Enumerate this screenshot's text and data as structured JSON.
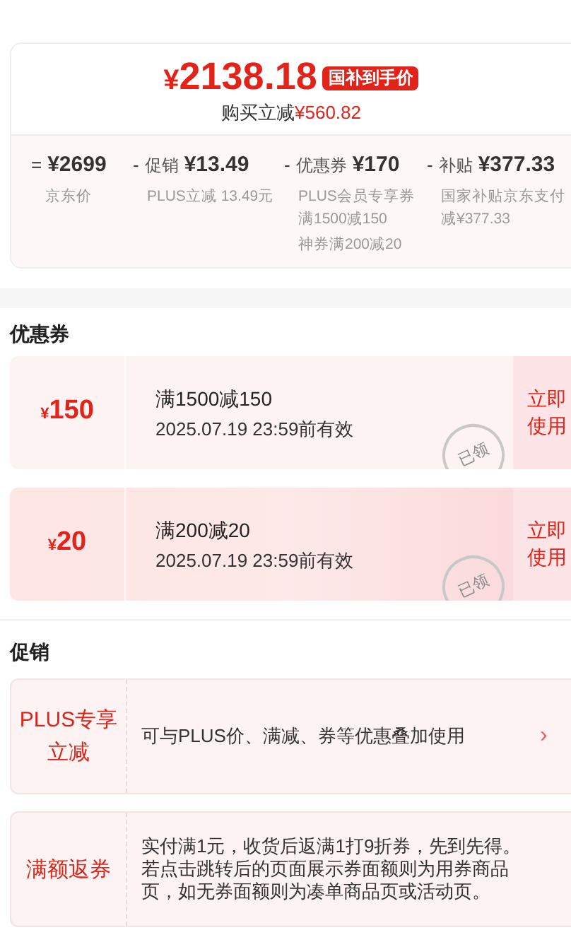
{
  "price": {
    "currency": "¥",
    "amount": "2138.18",
    "badge": "国补到手价",
    "saving_label": "购买立减",
    "saving": "¥560.82"
  },
  "breakdown": [
    {
      "op": "=",
      "amount": "¥2699",
      "notes": [
        "京东价"
      ]
    },
    {
      "op": "-",
      "label": "促销",
      "amount": "¥13.49",
      "notes": [
        "PLUS立减 13.49元"
      ]
    },
    {
      "op": "-",
      "label": "优惠券",
      "amount": "¥170",
      "notes": [
        "PLUS会员专享券满1500减150",
        "神券满200减20"
      ]
    },
    {
      "op": "-",
      "label": "补贴",
      "amount": "¥377.33",
      "notes": [
        "国家补贴京东支付减¥377.33"
      ]
    }
  ],
  "coupons_title": "优惠券",
  "coupons": [
    {
      "currency": "¥",
      "value": "150",
      "rule": "满1500减150",
      "validity": "2025.07.19 23:59前有效",
      "stamp": "已领",
      "claimed": true,
      "kind": "plain",
      "action": "立即使用"
    },
    {
      "currency": "¥",
      "value": "20",
      "rule": "满200减20",
      "validity": "2025.07.19 23:59前有效",
      "stamp": "已领",
      "claimed": true,
      "kind": "special",
      "action": "立即使用"
    }
  ],
  "promotions_title": "促销",
  "promotions": [
    {
      "tag": "PLUS专享立减",
      "text": "可与PLUS价、满减、券等优惠叠加使用",
      "chevron": "›"
    },
    {
      "tag": "满额返券",
      "text": "实付满1元，收货后返满1打9折券，先到先得。若点击跳转后的页面展示券面额则为用券商品页，如无券面额则为凑单商品页或活动页。"
    }
  ]
}
